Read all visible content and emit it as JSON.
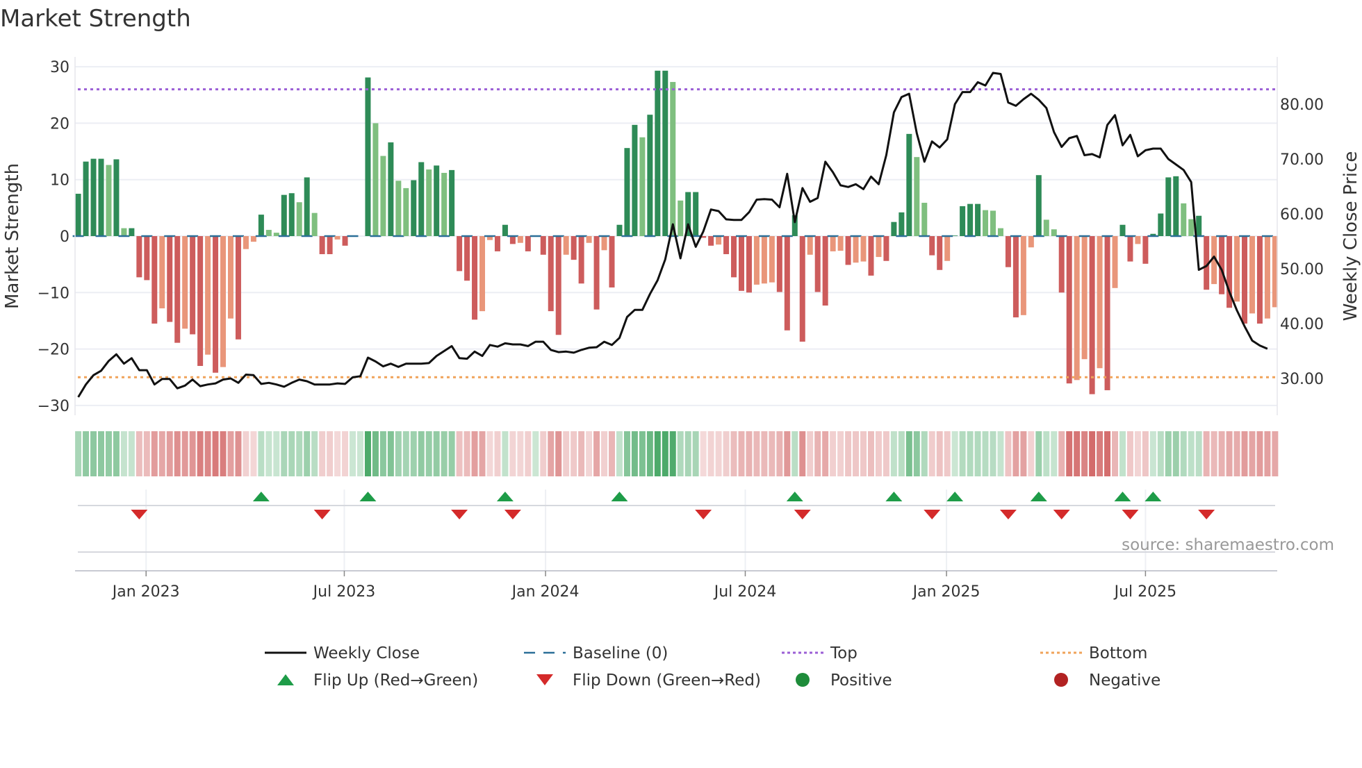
{
  "chart_data": {
    "type": "bar",
    "title": "Market Strength",
    "ylabel": "Market Strength",
    "y2label": "Weekly Close Price",
    "ylim": [
      -32,
      31
    ],
    "y2lim": [
      24,
      88
    ],
    "y_ticks": [
      30,
      20,
      10,
      0,
      -10,
      -20,
      -30
    ],
    "y_tick_labels": [
      "30",
      "20",
      "10",
      "0",
      "−10",
      "−20",
      "−30"
    ],
    "y2_ticks": [
      80,
      70,
      60,
      50,
      40,
      30
    ],
    "y2_tick_labels": [
      "80.00",
      "70.00",
      "60.00",
      "50.00",
      "40.00",
      "30.00"
    ],
    "x_unit": "week index",
    "x_ticks": [
      {
        "label": "Jan 2023",
        "week": 8.9
      },
      {
        "label": "Jul 2023",
        "week": 34.9
      },
      {
        "label": "Jan 2024",
        "week": 61.3
      },
      {
        "label": "Jul 2024",
        "week": 87.5
      },
      {
        "label": "Jan 2025",
        "week": 113.9
      },
      {
        "label": "Jul 2025",
        "week": 140.0
      }
    ],
    "top_level": 26,
    "bottom_level": -25,
    "baseline": 0,
    "strength": [
      7.5,
      13.2,
      13.7,
      13.7,
      12.6,
      13.6,
      1.4,
      1.4,
      -7.3,
      -7.8,
      -15.5,
      -12.8,
      -15.2,
      -18.9,
      -16.4,
      -17.4,
      -23,
      -21,
      -24.2,
      -23.2,
      -14.6,
      -18.3,
      -2.3,
      -1,
      3.8,
      1.1,
      0.6,
      7.3,
      7.6,
      6,
      10.4,
      4.1,
      -3.2,
      -3.2,
      -0.6,
      -1.7,
      0,
      0,
      28.1,
      20,
      14.2,
      16.6,
      9.8,
      8.5,
      9.9,
      13.1,
      11.8,
      12.5,
      11.2,
      11.7,
      -6.2,
      -7.9,
      -14.8,
      -13.3,
      -0.7,
      -2.7,
      2.0,
      -1.4,
      -1.2,
      -2.7,
      0,
      -3.3,
      -13.3,
      -17.5,
      -3.3,
      -4.2,
      -8.4,
      -1.2,
      -13,
      -2.5,
      -9.1,
      2,
      15.6,
      19.7,
      17.5,
      21.5,
      29.3,
      29.3,
      27.3,
      6.3,
      7.8,
      7.8,
      -0.3,
      -1.7,
      -1.5,
      -3.2,
      -7.3,
      -9.7,
      -10,
      -8.6,
      -8.4,
      -8.2,
      -9.9,
      -16.7,
      3.7,
      -18.7,
      -3.3,
      -9.9,
      -12.3,
      -2.7,
      -2.6,
      -5.1,
      -4.7,
      -4.5,
      -7,
      -3.7,
      -4.4,
      2.5,
      4.2,
      18.1,
      14,
      5.9,
      -3.4,
      -6,
      -4.4,
      0.1,
      5.3,
      5.7,
      5.7,
      4.6,
      4.5,
      1.4,
      -5.5,
      -14.4,
      -14,
      -2,
      10.8,
      2.9,
      1.2,
      -10,
      -26.1,
      -25.5,
      -21.8,
      -28,
      -23.4,
      -27.3,
      -9.2,
      2,
      -4.5,
      -1.4,
      -4.9,
      0.4,
      4,
      10.4,
      10.6,
      5.8,
      3,
      3.6,
      -9.5,
      -8.5,
      -10.3,
      -12.7,
      -11.6,
      -15.5,
      -13.7,
      -15.5,
      -14.6,
      -12.6
    ],
    "weekly_close": [
      26.6,
      28.9,
      30.6,
      31.4,
      33.2,
      34.4,
      32.7,
      33.7,
      31.5,
      31.5,
      28.9,
      29.9,
      29.9,
      28.2,
      28.7,
      29.8,
      28.6,
      28.9,
      29.1,
      29.8,
      30,
      29.2,
      30.7,
      30.6,
      29,
      29.2,
      28.9,
      28.5,
      29.2,
      29.8,
      29.5,
      28.9,
      28.9,
      28.9,
      29.1,
      29,
      30.2,
      30.4,
      33.8,
      33.1,
      32.2,
      32.7,
      32.1,
      32.7,
      32.7,
      32.7,
      32.8,
      34.1,
      35,
      35.9,
      33.7,
      33.6,
      34.9,
      34.1,
      36.1,
      35.8,
      36.4,
      36.2,
      36.2,
      35.9,
      36.7,
      36.7,
      35.2,
      34.8,
      34.9,
      34.7,
      35.2,
      35.6,
      35.7,
      36.7,
      36.1,
      37.4,
      41.2,
      42.5,
      42.5,
      45.4,
      47.9,
      51.7,
      58.1,
      51.9,
      58.1,
      54,
      56.8,
      60.8,
      60.5,
      59,
      58.9,
      58.9,
      60.3,
      62.6,
      62.7,
      62.6,
      61.2,
      67.3,
      58.5,
      64.7,
      62.2,
      62.9,
      69.5,
      67.6,
      65.2,
      64.9,
      65.4,
      64.5,
      66.8,
      65.4,
      70.7,
      78.5,
      81.3,
      81.9,
      74.7,
      69.5,
      73.2,
      72.1,
      73.6,
      80,
      82.2,
      82.2,
      84,
      83.4,
      85.7,
      85.5,
      80.3,
      79.7,
      80.9,
      81.9,
      80.8,
      79.3,
      74.9,
      72.2,
      73.8,
      74.2,
      70.7,
      70.9,
      70.3,
      76.2,
      78,
      72.5,
      74.4,
      70.5,
      71.6,
      71.9,
      71.9,
      70,
      69,
      68,
      65.8,
      49.8,
      50.5,
      52.2,
      49.8,
      45.8,
      42.4,
      39.5,
      36.9,
      36,
      35.4
    ],
    "flip_up_weeks": [
      24,
      38,
      56,
      71,
      94,
      107,
      115,
      126,
      137,
      141
    ],
    "flip_down_weeks": [
      8,
      32,
      50,
      57,
      82,
      95,
      112,
      122,
      129,
      138,
      148
    ],
    "legend": [
      {
        "label": "Weekly Close",
        "kind": "line"
      },
      {
        "label": "Baseline (0)",
        "kind": "dash"
      },
      {
        "label": "Top",
        "kind": "dot-top"
      },
      {
        "label": "Bottom",
        "kind": "dot-bottom"
      },
      {
        "label": "Flip Up (Red→Green)",
        "kind": "up"
      },
      {
        "label": "Flip Down (Green→Red)",
        "kind": "down"
      },
      {
        "label": "Positive",
        "kind": "pos"
      },
      {
        "label": "Negative",
        "kind": "neg"
      }
    ],
    "legend_placement": "bottom",
    "colors": {
      "pos_strong": "#2e8b57",
      "pos_weak": "#7fbf7f",
      "neg_strong": "#cd5c5c",
      "neg_weak": "#e9967a",
      "line": "#111111",
      "baseline": "#2b6f98",
      "top": "#9b5fd6",
      "bottom": "#f0a35a",
      "flip_up": "#1e9c48",
      "flip_down": "#d42a2a",
      "positive": "#1e8c3a",
      "negative": "#b22222"
    }
  },
  "source": "source: sharemaestro.com"
}
